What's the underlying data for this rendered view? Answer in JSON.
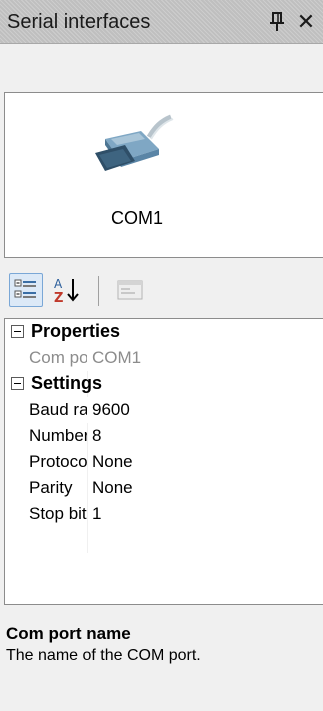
{
  "window": {
    "title": "Serial interfaces",
    "pin_icon": "pin-icon",
    "close_icon": "close-icon"
  },
  "device_list": {
    "items": [
      {
        "label": "COM1",
        "icon": "serial-cable-icon"
      }
    ]
  },
  "toolbar": {
    "buttons": [
      {
        "icon": "categorized-icon",
        "active": true
      },
      {
        "icon": "sort-alphabetical-icon",
        "active": false
      },
      {
        "icon": "property-pages-icon",
        "active": false,
        "disabled": true
      }
    ]
  },
  "property_grid": {
    "categories": [
      {
        "label": "Properties",
        "properties": [
          {
            "name": "Com po",
            "value": "COM1",
            "readonly": true
          }
        ]
      },
      {
        "label": "Settings",
        "properties": [
          {
            "name": "Baud ra",
            "value": "9600"
          },
          {
            "name": "Number",
            "value": "8"
          },
          {
            "name": "Protoco",
            "value": "None"
          },
          {
            "name": "Parity",
            "value": "None"
          },
          {
            "name": "Stop bit",
            "value": "1"
          }
        ]
      }
    ]
  },
  "description": {
    "title": "Com port name",
    "text": "The name of the COM port."
  },
  "colors": {
    "titlebar": "#bfbfbf",
    "panel_bg": "#f0f0f0",
    "readonly_text": "#8c8c8c",
    "selected_button": "#dce9f7"
  }
}
